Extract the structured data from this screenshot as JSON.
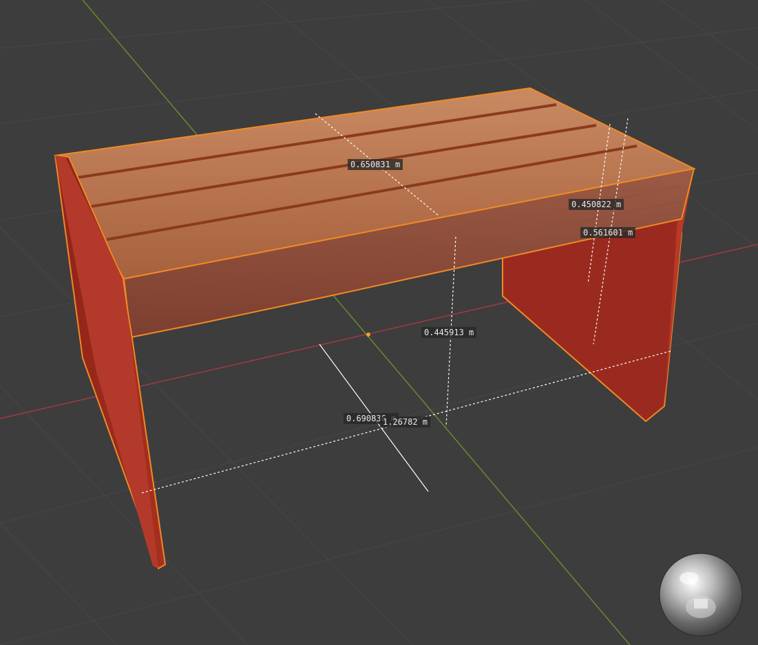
{
  "viewport": {
    "background": "#3d3d3d",
    "grid_color": "#474747",
    "x_axis_color": "#a13a45",
    "y_axis_color": "#6a8a2e",
    "selection_outline_color": "#f08a24"
  },
  "object": {
    "name_icon": "bench-model",
    "plank_color": "#b9734c",
    "frame_color": "#9a2a1f"
  },
  "measurements": [
    {
      "id": "seat-depth",
      "text": "0.650831 m"
    },
    {
      "id": "leg-depth-a",
      "text": "0.450822 m"
    },
    {
      "id": "leg-depth-b",
      "text": "0.561601 m"
    },
    {
      "id": "seat-height",
      "text": "0.445913 m"
    },
    {
      "id": "leg-width",
      "text": "0.690836 m"
    },
    {
      "id": "bench-length",
      "text": "1.26782 m"
    }
  ],
  "hdri_preview": {
    "icon": "hdri-sphere-icon"
  }
}
